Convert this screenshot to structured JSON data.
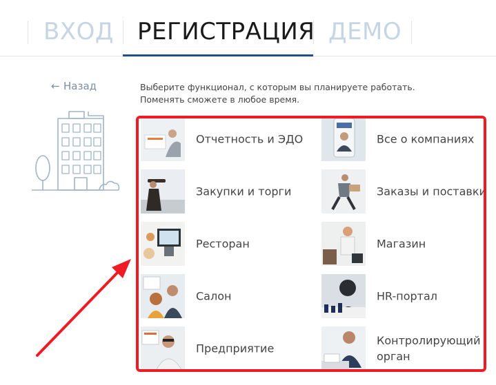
{
  "tabs": [
    {
      "label": "ВХОД",
      "state": "inactive"
    },
    {
      "label": "РЕГИСТРАЦИЯ",
      "state": "active"
    },
    {
      "label": "ДЕМО",
      "state": "inactive"
    }
  ],
  "back": {
    "arrow": "←",
    "label": "Назад"
  },
  "instruction": {
    "line1": "Выберите функционал, с которым вы планируете работать.",
    "line2": "Поменять сможете в любое время."
  },
  "options": [
    {
      "label": "Отчетность и ЭДО",
      "icon": "reporting-photo"
    },
    {
      "label": "Все о компаниях",
      "icon": "companies-photo"
    },
    {
      "label": "Закупки и торги",
      "icon": "purchases-photo"
    },
    {
      "label": "Заказы и поставки",
      "icon": "orders-photo"
    },
    {
      "label": "Ресторан",
      "icon": "restaurant-photo"
    },
    {
      "label": "Магазин",
      "icon": "shop-photo"
    },
    {
      "label": "Салон",
      "icon": "salon-photo"
    },
    {
      "label": "HR-портал",
      "icon": "hr-photo"
    },
    {
      "label": "Предприятие",
      "icon": "enterprise-photo"
    },
    {
      "label": "Контролирующий",
      "label2": "орган",
      "icon": "inspector-photo"
    }
  ],
  "colors": {
    "active_tab": "#1a1a1a",
    "inactive_tab": "#c5d5e4",
    "underline": "#1e4f86",
    "highlight": "#ee1b24",
    "back_link": "#7b8ea3"
  }
}
